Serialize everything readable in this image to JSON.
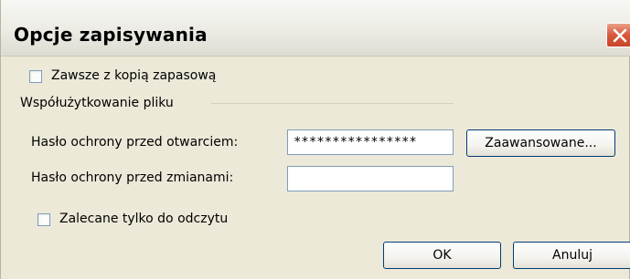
{
  "dialog": {
    "title": "Opcje zapisywania",
    "close_icon": "close-icon"
  },
  "options": {
    "always_backup_label": "Zawsze z kopią zapasową",
    "always_backup_checked": false
  },
  "file_sharing": {
    "group_label": "Współużytkowanie pliku",
    "open_password_label": "Hasło ochrony przed otwarciem:",
    "open_password_value": "****************",
    "modify_password_label": "Hasło ochrony przed zmianami:",
    "modify_password_value": "",
    "advanced_button": "Zaawansowane...",
    "read_only_label": "Zalecane tylko do odczytu",
    "read_only_checked": false
  },
  "buttons": {
    "ok": "OK",
    "cancel": "Anuluj"
  },
  "colors": {
    "dialog_bg": "#ece9d8",
    "close_button": "#d8573a",
    "input_border": "#7f9db9",
    "button_border": "#003c74"
  }
}
